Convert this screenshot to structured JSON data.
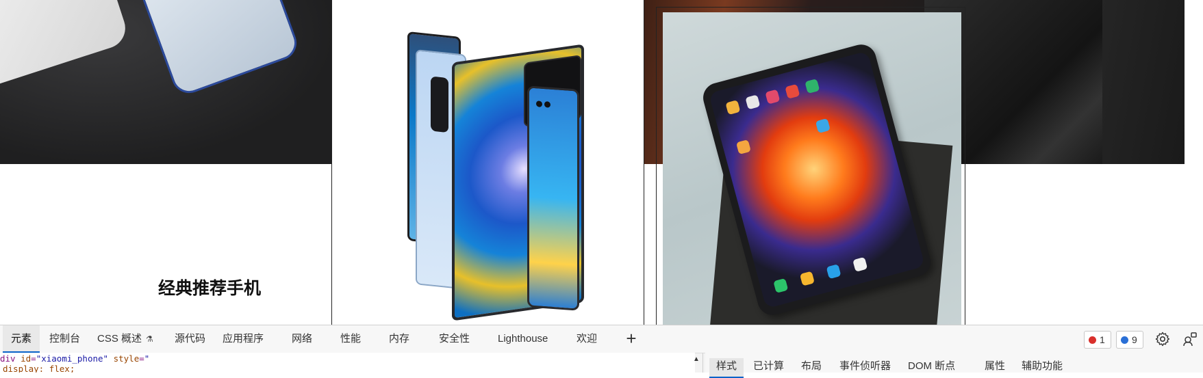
{
  "page": {
    "section_title": "经典推荐手机"
  },
  "devtools": {
    "tabs": [
      {
        "label": "元素",
        "active": true
      },
      {
        "label": "控制台"
      },
      {
        "label": "CSS 概述"
      },
      {
        "label": "源代码"
      },
      {
        "label": "应用程序"
      },
      {
        "label": "网络"
      },
      {
        "label": "性能"
      },
      {
        "label": "内存"
      },
      {
        "label": "安全性"
      },
      {
        "label": "Lighthouse"
      },
      {
        "label": "欢迎"
      }
    ],
    "add_tab_icon": "plus-icon",
    "error_count": "1",
    "message_count": "9",
    "code": {
      "line1_tag_open": "div ",
      "line1_attr_id": "id",
      "line1_eq1": "=",
      "line1_val_id": "\"xiaomi_phone\"",
      "line1_attr_style": " style",
      "line1_eq2": "=",
      "line1_val_style": "\"",
      "line2": "display: flex;"
    },
    "style_tabs": [
      {
        "label": "样式",
        "active": true
      },
      {
        "label": "已计算"
      },
      {
        "label": "布局"
      },
      {
        "label": "事件侦听器"
      },
      {
        "label": "DOM 断点"
      },
      {
        "label": "属性"
      },
      {
        "label": "辅助功能"
      }
    ],
    "colors": {
      "accent": "#0a63c9",
      "error": "#d9302c",
      "message": "#2a6fd6"
    }
  }
}
